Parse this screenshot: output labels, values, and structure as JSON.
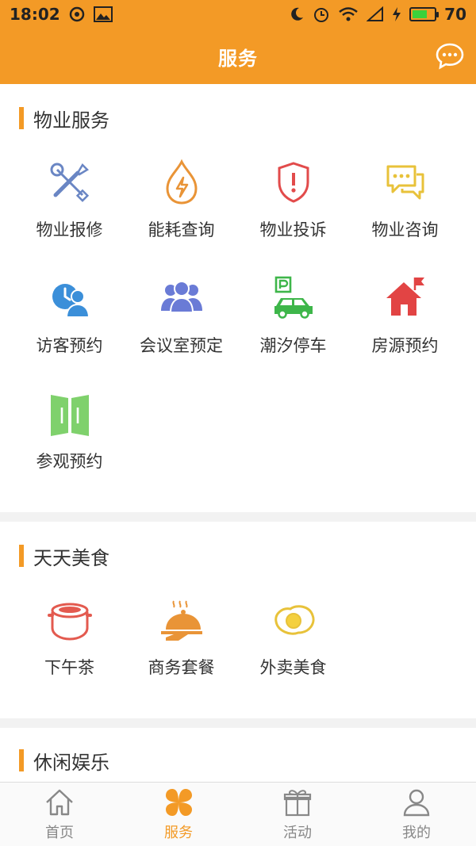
{
  "status": {
    "time": "18:02",
    "battery": "70",
    "battery_level": 0.7
  },
  "header": {
    "title": "服务"
  },
  "sections": [
    {
      "title": "物业服务",
      "items": [
        {
          "label": "物业报修"
        },
        {
          "label": "能耗查询"
        },
        {
          "label": "物业投诉"
        },
        {
          "label": "物业咨询"
        },
        {
          "label": "访客预约"
        },
        {
          "label": "会议室预定"
        },
        {
          "label": "潮汐停车"
        },
        {
          "label": "房源预约"
        },
        {
          "label": "参观预约"
        }
      ]
    },
    {
      "title": "天天美食",
      "items": [
        {
          "label": "下午茶"
        },
        {
          "label": "商务套餐"
        },
        {
          "label": "外卖美食"
        }
      ]
    },
    {
      "title": "休闲娱乐",
      "items": []
    }
  ],
  "tabs": [
    {
      "label": "首页"
    },
    {
      "label": "服务"
    },
    {
      "label": "活动"
    },
    {
      "label": "我的"
    }
  ],
  "colors": {
    "accent": "#f39a26"
  }
}
